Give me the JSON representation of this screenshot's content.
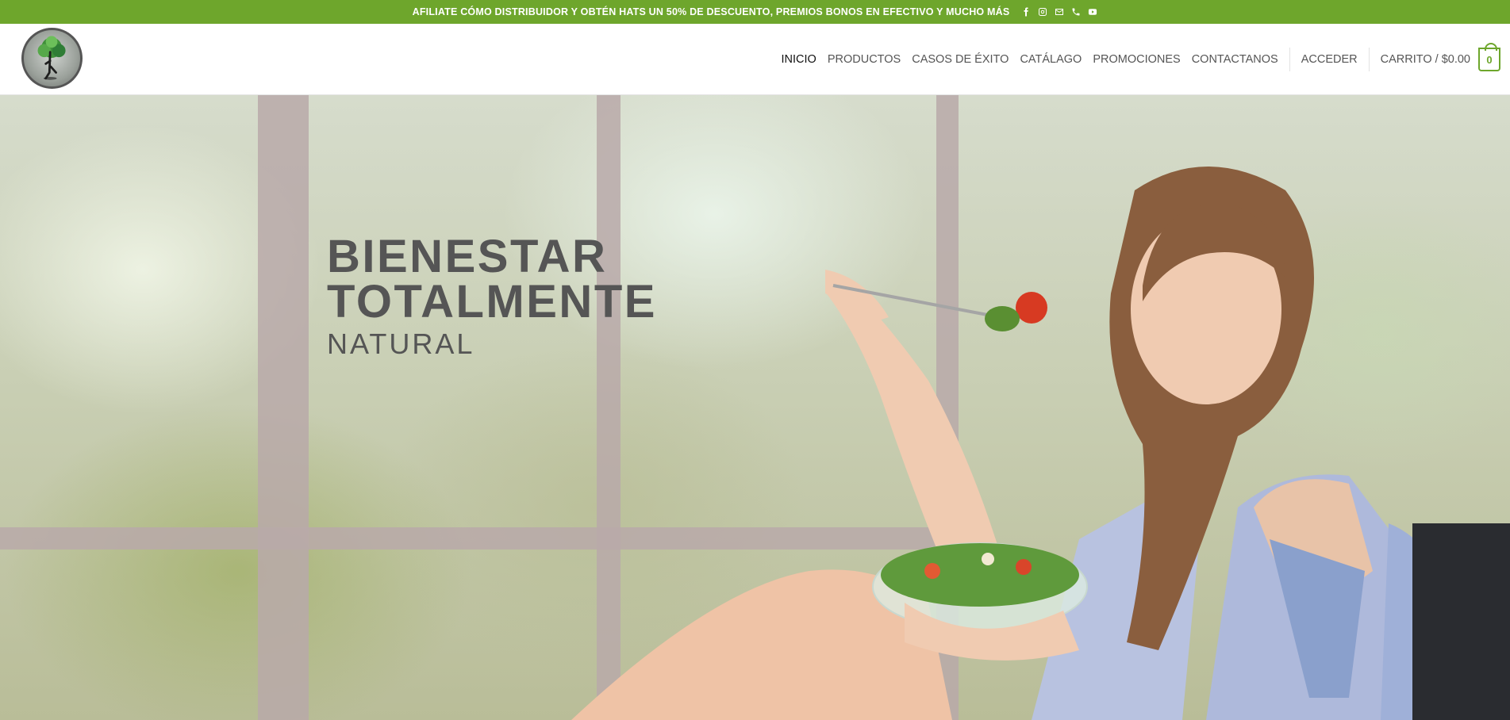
{
  "topbar": {
    "announcement": "AFILIATE CÓMO DISTRIBUIDOR Y OBTÉN HATS UN 50% DE DESCUENTO, PREMIOS BONOS EN EFECTIVO Y MUCHO MÁS",
    "socials": [
      "facebook-icon",
      "instagram-icon",
      "email-icon",
      "phone-icon",
      "youtube-icon"
    ]
  },
  "nav": {
    "items": [
      "INICIO",
      "PRODUCTOS",
      "CASOS DE ÉXITO",
      "CATÁLAGO",
      "PROMOCIONES",
      "CONTACTANOS"
    ],
    "active": "INICIO",
    "login": "ACCEDER",
    "cart_label": "CARRITO / $0.00",
    "cart_count": "0"
  },
  "hero": {
    "line1": "BIENESTAR",
    "line2": "TOTALMENTE",
    "line3": "NATURAL"
  },
  "colors": {
    "brand_green": "#6ea62c",
    "hero_text": "#555555"
  }
}
